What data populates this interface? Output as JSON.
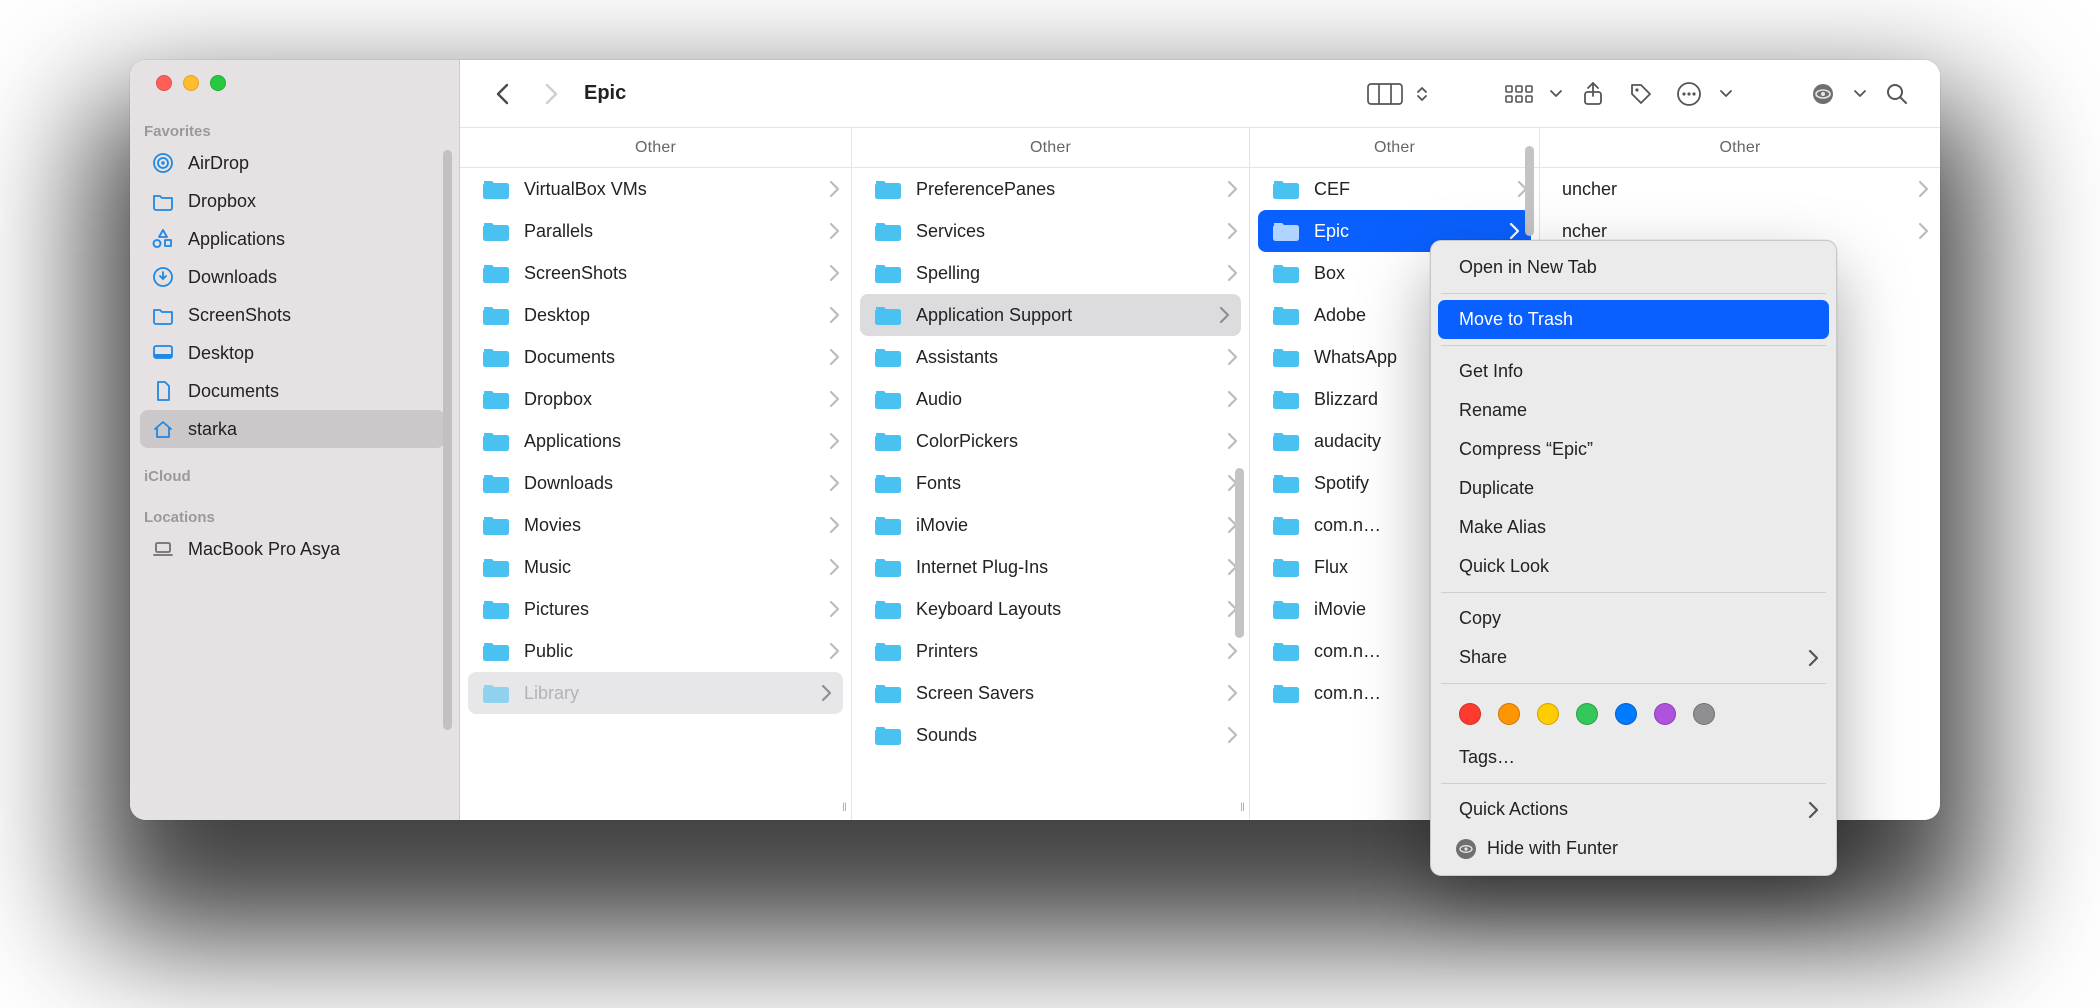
{
  "window": {
    "title": "Epic"
  },
  "sidebar": {
    "sections": [
      {
        "title": "Favorites",
        "items": [
          {
            "icon": "airdrop",
            "label": "AirDrop"
          },
          {
            "icon": "folder",
            "label": "Dropbox"
          },
          {
            "icon": "apps",
            "label": "Applications"
          },
          {
            "icon": "download",
            "label": "Downloads"
          },
          {
            "icon": "folder",
            "label": "ScreenShots"
          },
          {
            "icon": "desktop",
            "label": "Desktop"
          },
          {
            "icon": "doc",
            "label": "Documents"
          },
          {
            "icon": "home",
            "label": "starka",
            "selected": true
          }
        ]
      },
      {
        "title": "iCloud",
        "items": []
      },
      {
        "title": "Locations",
        "items": [
          {
            "icon": "laptop",
            "label": "MacBook Pro Asya",
            "gray": true
          }
        ]
      }
    ]
  },
  "columns": [
    {
      "header": "Other",
      "items": [
        {
          "name": "VirtualBox VMs"
        },
        {
          "name": "Parallels"
        },
        {
          "name": "ScreenShots"
        },
        {
          "name": "Desktop"
        },
        {
          "name": "Documents"
        },
        {
          "name": "Dropbox"
        },
        {
          "name": "Applications"
        },
        {
          "name": "Downloads"
        },
        {
          "name": "Movies"
        },
        {
          "name": "Music"
        },
        {
          "name": "Pictures"
        },
        {
          "name": "Public"
        },
        {
          "name": "Library",
          "selected": true,
          "dim": true
        }
      ]
    },
    {
      "header": "Other",
      "items": [
        {
          "name": "PreferencePanes"
        },
        {
          "name": "Services"
        },
        {
          "name": "Spelling"
        },
        {
          "name": "Application Support",
          "selected": true
        },
        {
          "name": "Assistants"
        },
        {
          "name": "Audio"
        },
        {
          "name": "ColorPickers"
        },
        {
          "name": "Fonts"
        },
        {
          "name": "iMovie"
        },
        {
          "name": "Internet Plug-Ins"
        },
        {
          "name": "Keyboard Layouts"
        },
        {
          "name": "Printers"
        },
        {
          "name": "Screen Savers"
        },
        {
          "name": "Sounds"
        }
      ]
    },
    {
      "header": "Other",
      "items": [
        {
          "name": "CEF"
        },
        {
          "name": "Epic",
          "selectedBlue": true
        },
        {
          "name": "Box"
        },
        {
          "name": "Adobe"
        },
        {
          "name": "WhatsApp"
        },
        {
          "name": "Blizzard"
        },
        {
          "name": "audacity"
        },
        {
          "name": "Spotify"
        },
        {
          "name": "com.n…"
        },
        {
          "name": "Flux"
        },
        {
          "name": "iMovie"
        },
        {
          "name": "com.n…"
        },
        {
          "name": "com.n…"
        }
      ]
    },
    {
      "header": "Other",
      "items": [
        {
          "name": "uncher",
          "nofolder": true
        },
        {
          "name": "ncher",
          "nofolder": true
        }
      ]
    }
  ],
  "context_menu": {
    "open_new_tab": "Open in New Tab",
    "move_to_trash": "Move to Trash",
    "get_info": "Get Info",
    "rename": "Rename",
    "compress": "Compress “Epic”",
    "duplicate": "Duplicate",
    "make_alias": "Make Alias",
    "quick_look": "Quick Look",
    "copy": "Copy",
    "share": "Share",
    "tags": "Tags…",
    "quick_actions": "Quick Actions",
    "hide_with_funter": "Hide with Funter",
    "tag_colors": [
      "#ff3b30",
      "#ff9500",
      "#ffcc00",
      "#34c759",
      "#007aff",
      "#af52de",
      "#8e8e93"
    ]
  }
}
